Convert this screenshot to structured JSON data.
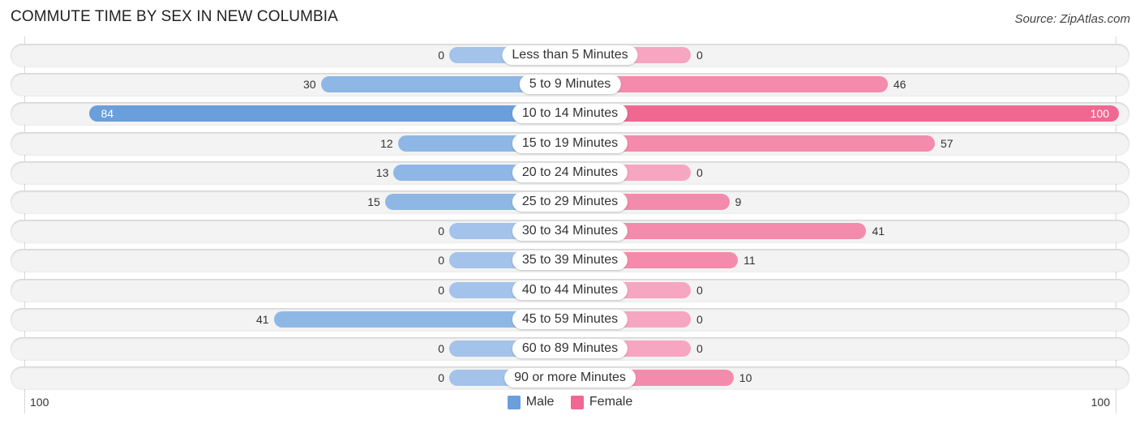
{
  "title": "COMMUTE TIME BY SEX IN NEW COLUMBIA",
  "source": "Source: ZipAtlas.com",
  "colors": {
    "male": "#6a9fdb",
    "male_light": "#a4c3ea",
    "female": "#f06892",
    "female_light": "#f6a6c0"
  },
  "chart_data": {
    "type": "bar",
    "orientation": "horizontal-diverging",
    "title": "COMMUTE TIME BY SEX IN NEW COLUMBIA",
    "categories": [
      "Less than 5 Minutes",
      "5 to 9 Minutes",
      "10 to 14 Minutes",
      "15 to 19 Minutes",
      "20 to 24 Minutes",
      "25 to 29 Minutes",
      "30 to 34 Minutes",
      "35 to 39 Minutes",
      "40 to 44 Minutes",
      "45 to 59 Minutes",
      "60 to 89 Minutes",
      "90 or more Minutes"
    ],
    "series": [
      {
        "name": "Male",
        "values": [
          0,
          30,
          84,
          12,
          13,
          15,
          0,
          0,
          0,
          41,
          0,
          0
        ]
      },
      {
        "name": "Female",
        "values": [
          0,
          46,
          100,
          57,
          0,
          9,
          41,
          11,
          0,
          0,
          0,
          10
        ]
      }
    ],
    "axis": {
      "left_label": "100",
      "right_label": "100",
      "range": [
        0,
        100
      ]
    },
    "legend": {
      "entries": [
        "Male",
        "Female"
      ],
      "placement": "bottom-center"
    }
  }
}
